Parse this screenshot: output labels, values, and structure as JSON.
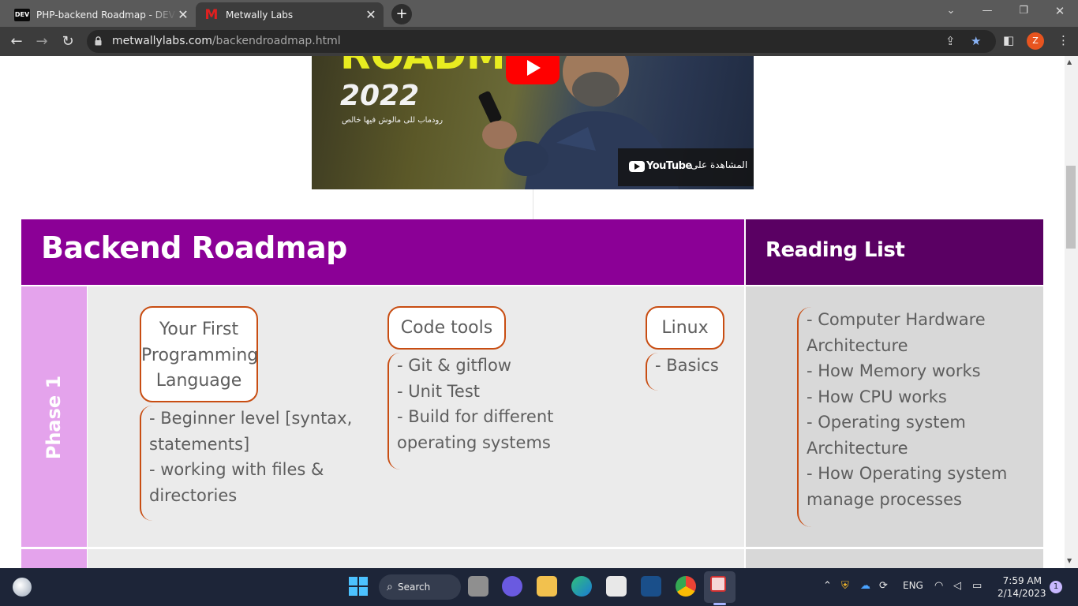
{
  "browser": {
    "tabs": [
      {
        "favicon": "dev-logo-icon",
        "title": "PHP-backend Roadmap - DEV Community",
        "active": false
      },
      {
        "favicon": "metwally-logo-icon",
        "title": "Metwally Labs",
        "active": true
      }
    ],
    "url_host": "metwallylabs.com",
    "url_path": "/backendroadmap.html",
    "profile_initial": "Z"
  },
  "video": {
    "headline": "ROADMA",
    "year": "2022",
    "subtitle_ar": "رودماب للى مالوش فيها خالص",
    "watch_on_ar": "المشاهدة على",
    "platform": "YouTube"
  },
  "roadmap": {
    "title": "Backend Roadmap",
    "reading_title": "Reading List",
    "phase_label": "Phase 1",
    "topics": [
      {
        "title_lines": [
          "Your First",
          "Programming",
          "Language"
        ],
        "items": [
          "- Beginner level [syntax,",
          "statements]",
          "- working with files &",
          "directories"
        ]
      },
      {
        "title_lines": [
          "Code tools"
        ],
        "items": [
          "- Git & gitflow",
          "- Unit Test",
          "- Build for different",
          "operating systems"
        ]
      },
      {
        "title_lines": [
          "Linux"
        ],
        "items": [
          "- Basics"
        ]
      }
    ],
    "reading_items": [
      "- Computer Hardware",
      "Architecture",
      "- How Memory works",
      "- How CPU works",
      "- Operating system",
      "Architecture",
      "- How Operating system",
      "manage processes"
    ]
  },
  "taskbar": {
    "search_label": "Search",
    "language": "ENG",
    "time": "7:59 AM",
    "date": "2/14/2023",
    "notification_count": "1"
  },
  "colors": {
    "header_purple": "#8b0096",
    "reading_purple": "#5a0063",
    "phase_pink": "#e4a3ec",
    "accent_orange": "#c84d12"
  }
}
